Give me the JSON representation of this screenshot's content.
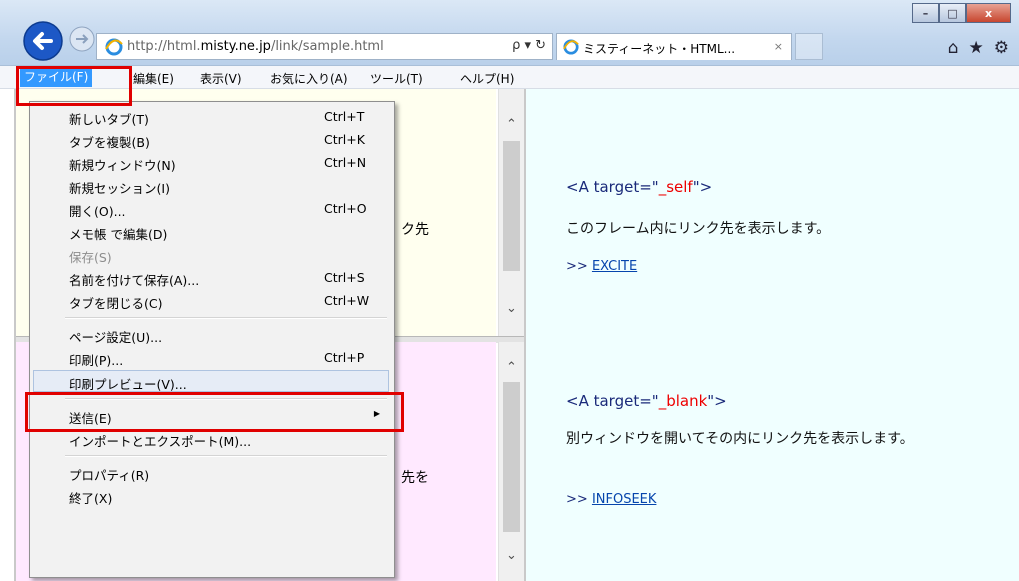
{
  "browser": {
    "url": {
      "prefix": "http://html.",
      "host": "misty.ne.jp",
      "path": "/link/sample.html"
    },
    "address_tools": "ρ ▾ ↻",
    "tab_title": "ミスティーネット・HTML...",
    "tab_close": "×",
    "home_icon": "home-icon",
    "fav_icon": "star-icon",
    "tools_icon": "gear-icon",
    "window_buttons": {
      "minimize": "–",
      "maximize": "□",
      "close": "x"
    }
  },
  "menubar": {
    "items": [
      "ファイル(F)",
      "編集(E)",
      "表示(V)",
      "お気に入り(A)",
      "ツール(T)",
      "ヘルプ(H)"
    ],
    "active_index": 0
  },
  "file_menu": {
    "groups": [
      [
        {
          "label": "新しいタブ(T)",
          "shortcut": "Ctrl+T"
        },
        {
          "label": "タブを複製(B)",
          "shortcut": "Ctrl+K"
        },
        {
          "label": "新規ウィンドウ(N)",
          "shortcut": "Ctrl+N"
        },
        {
          "label": "新規セッション(I)",
          "shortcut": ""
        },
        {
          "label": "開く(O)...",
          "shortcut": "Ctrl+O"
        },
        {
          "label": "メモ帳 で編集(D)",
          "shortcut": ""
        },
        {
          "label": "保存(S)",
          "shortcut": "",
          "disabled": true
        },
        {
          "label": "名前を付けて保存(A)...",
          "shortcut": "Ctrl+S"
        },
        {
          "label": "タブを閉じる(C)",
          "shortcut": "Ctrl+W"
        }
      ],
      [
        {
          "label": "ページ設定(U)...",
          "shortcut": ""
        },
        {
          "label": "印刷(P)...",
          "shortcut": "Ctrl+P"
        },
        {
          "label": "印刷プレビュー(V)...",
          "shortcut": "",
          "highlighted": true
        }
      ],
      [
        {
          "label": "送信(E)",
          "shortcut": "",
          "submenu": true
        },
        {
          "label": "インポートとエクスポート(M)...",
          "shortcut": ""
        }
      ],
      [
        {
          "label": "プロパティ(R)",
          "shortcut": ""
        },
        {
          "label": "終了(X)",
          "shortcut": ""
        }
      ]
    ]
  },
  "left_frame": {
    "top_fragment": "ク先",
    "bottom_fragment": "先を"
  },
  "right_frame": {
    "self": {
      "tag_open": "<A target=\"",
      "value": "_self",
      "tag_close": "\">",
      "desc": "このフレーム内にリンク先を表示します。",
      "link_prefix": ">>",
      "link_text": "EXCITE"
    },
    "blank": {
      "tag_open": "<A target=\"",
      "value": "_blank",
      "tag_close": "\">",
      "desc": "別ウィンドウを開いてその内にリンク先を表示します。",
      "link_prefix": ">>",
      "link_text": "INFOSEEK"
    }
  },
  "colors": {
    "highlight": "#e00000",
    "menu_active": "#3399ff",
    "link": "#0645ad"
  }
}
